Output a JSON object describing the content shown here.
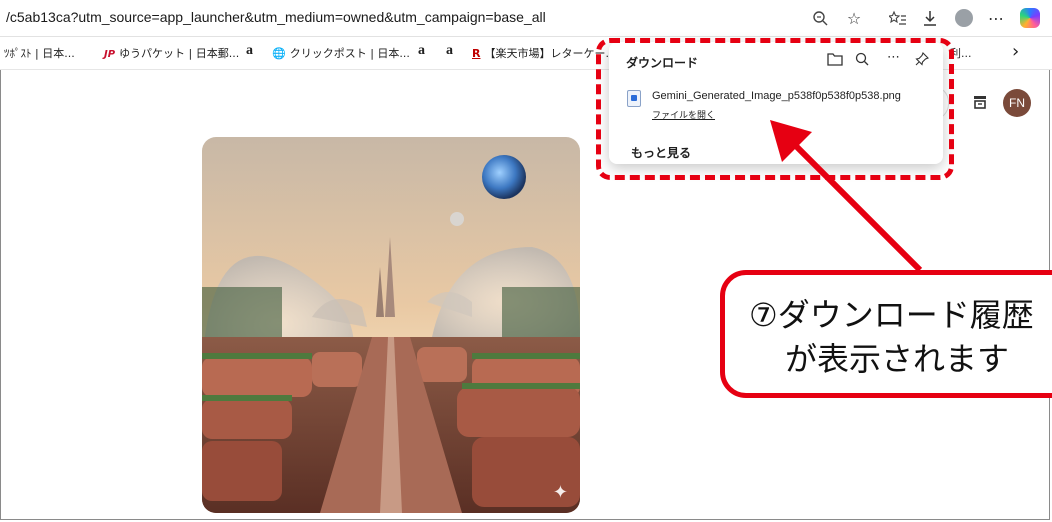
{
  "browser": {
    "url": "/c5ab13ca?utm_source=app_launcher&utm_medium=owned&utm_campaign=base_all",
    "toolbar_icons": [
      "zoom-icon",
      "favorite-star-icon",
      "favorites-list-icon",
      "download-icon",
      "profile-icon",
      "more-icon",
      "copilot-icon"
    ],
    "more_glyph": "⋯"
  },
  "bookmarks": {
    "items": [
      {
        "label": "ﾂﾎﾟｽﾄ | 日本...",
        "icon": ""
      },
      {
        "label": "ゆうパケット | 日本郵...",
        "icon": "JP"
      },
      {
        "label": "a",
        "icon": "amazon"
      },
      {
        "label": "クリックポスト | 日本...",
        "icon": "globe"
      },
      {
        "label": "a",
        "icon": "amazon"
      },
      {
        "label": "a",
        "icon": "amazon"
      },
      {
        "label": "【楽天市場】レターケー...",
        "icon": "R"
      },
      {
        "label": "利...",
        "icon": ""
      }
    ],
    "overflow": "›"
  },
  "page": {
    "avatar_initials": "FN"
  },
  "downloads": {
    "title": "ダウンロード",
    "filename": "Gemini_Generated_Image_p538f0p538f0p538.png",
    "open_file": "ファイルを開く",
    "see_more": "もっと見る",
    "tool_icons": [
      "folder-icon",
      "search-icon",
      "more-icon",
      "pin-icon"
    ]
  },
  "annotation": {
    "line1": "⑦ダウンロード履歴",
    "line2": "が表示されます",
    "color": "#e60012"
  }
}
